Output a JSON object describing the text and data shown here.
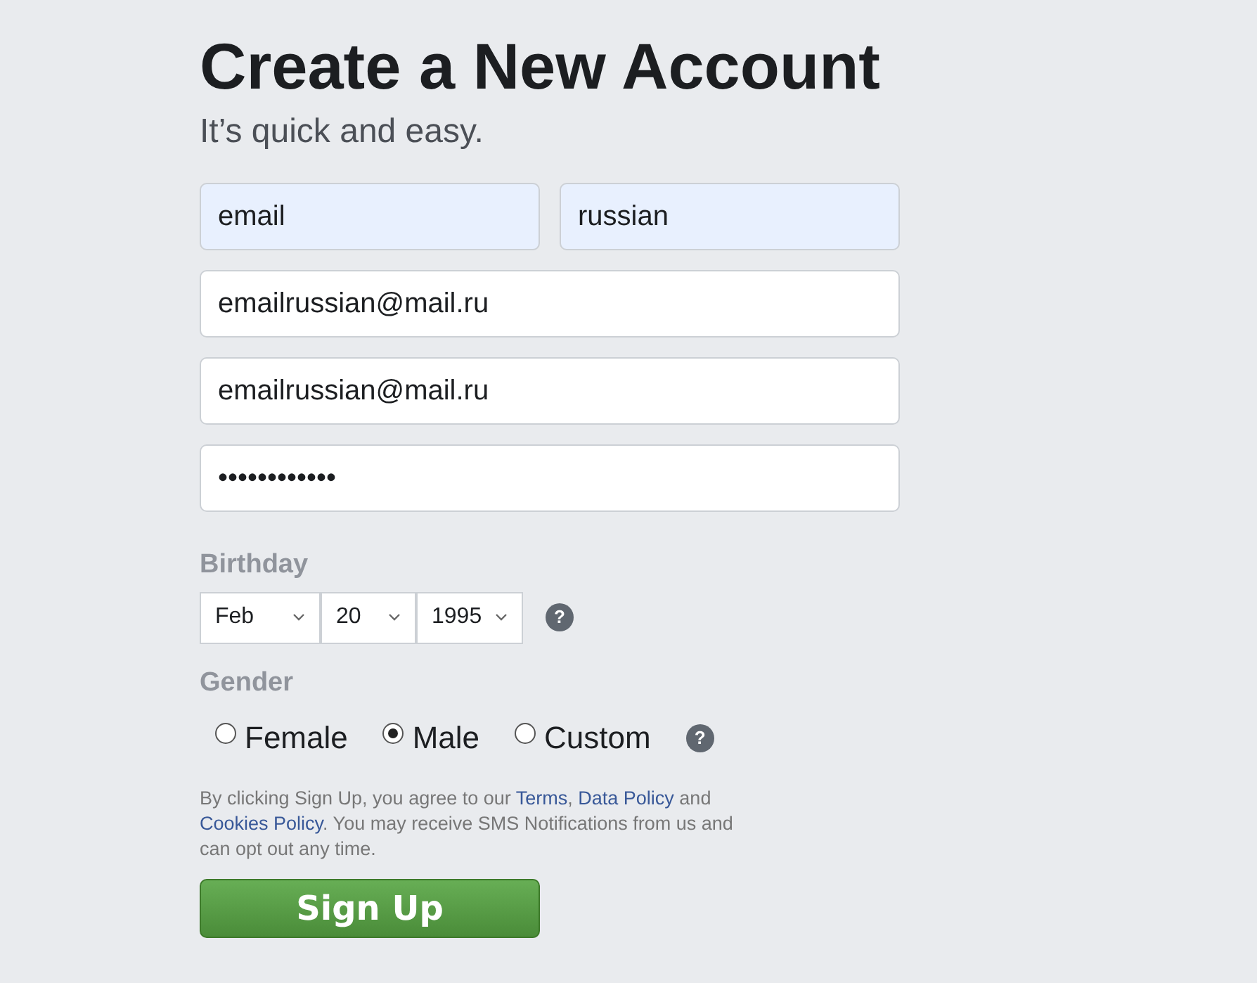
{
  "title": "Create a New Account",
  "subtitle": "It’s quick and easy.",
  "name_fields": [
    {
      "value": "email",
      "autofilled": true
    },
    {
      "value": "russian",
      "autofilled": true
    }
  ],
  "fields": [
    {
      "value": "emailrussian@mail.ru",
      "autofilled": false
    },
    {
      "value": "emailrussian@mail.ru",
      "autofilled": false
    },
    {
      "value": "••••••••••••",
      "autofilled": false
    }
  ],
  "birthday": {
    "label": "Birthday",
    "selects": [
      "Feb",
      "20",
      "1995"
    ],
    "help": "?"
  },
  "gender": {
    "label": "Gender",
    "options": [
      {
        "label": "Female",
        "selected": false
      },
      {
        "label": "Male",
        "selected": true
      },
      {
        "label": "Custom",
        "selected": false
      }
    ],
    "help": "?"
  },
  "legal": [
    {
      "kind": "text",
      "text": "By clicking Sign Up, you agree to our "
    },
    {
      "kind": "link",
      "text": "Terms"
    },
    {
      "kind": "text",
      "text": ", "
    },
    {
      "kind": "link",
      "text": "Data Policy"
    },
    {
      "kind": "text",
      "text": " and "
    },
    {
      "kind": "link",
      "text": "Cookies Policy"
    },
    {
      "kind": "text",
      "text": ". You may receive SMS Notifications from us and can opt out any time."
    }
  ],
  "button": "Sign Up"
}
